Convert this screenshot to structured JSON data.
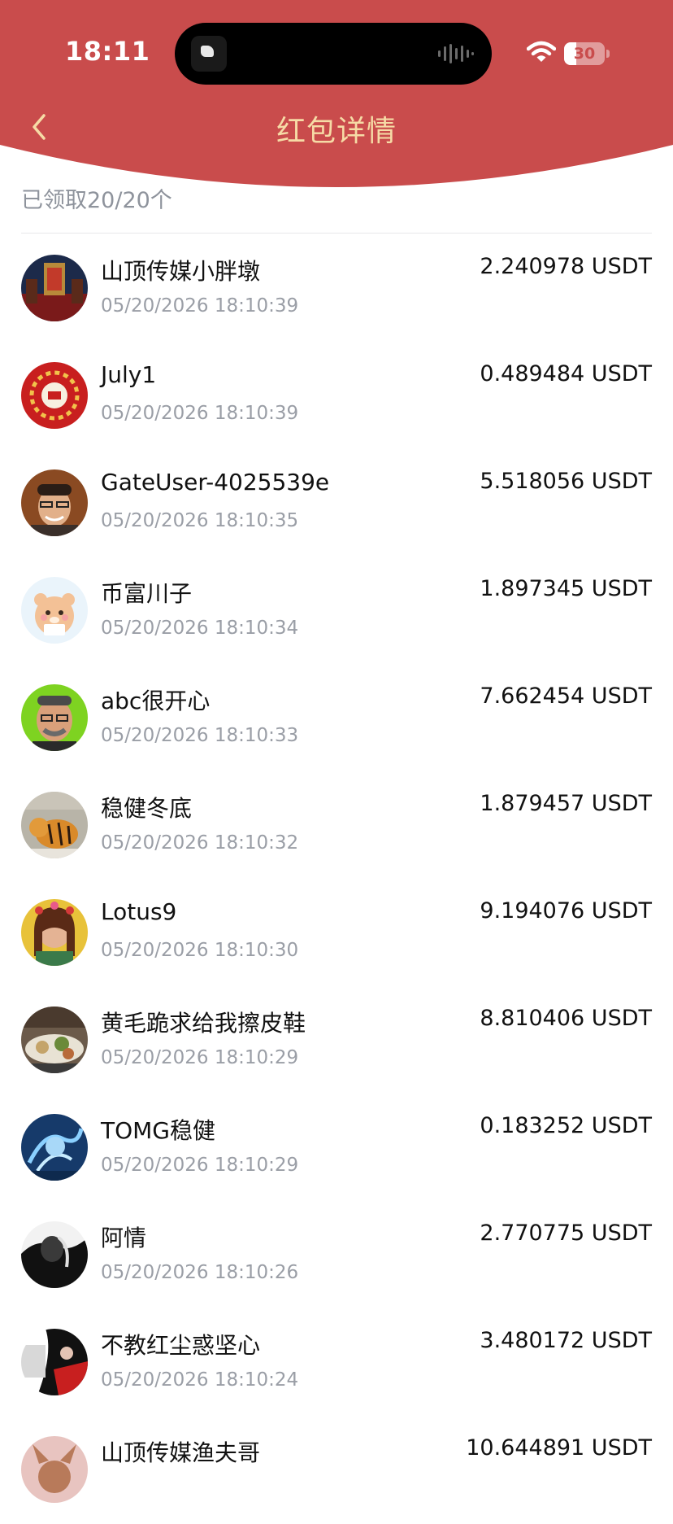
{
  "status_bar": {
    "time": "18:11",
    "battery_level": "30",
    "battery_fraction": 0.3
  },
  "header": {
    "title": "红包详情",
    "back_icon": "chevron-left-icon",
    "bg_color": "#c94c4c",
    "title_color": "#f6dba6"
  },
  "summary": {
    "text": "已领取20/20个"
  },
  "recipients": [
    {
      "name": "山顶传媒小胖墩",
      "time": "05/20/2026 18:10:39",
      "amount": "2.240978 USDT"
    },
    {
      "name": "July1",
      "time": "05/20/2026 18:10:39",
      "amount": "0.489484 USDT"
    },
    {
      "name": "GateUser-4025539e",
      "time": "05/20/2026 18:10:35",
      "amount": "5.518056 USDT"
    },
    {
      "name": "币富川子",
      "time": "05/20/2026 18:10:34",
      "amount": "1.897345 USDT"
    },
    {
      "name": "abc很开心",
      "time": "05/20/2026 18:10:33",
      "amount": "7.662454 USDT"
    },
    {
      "name": "稳健冬底",
      "time": "05/20/2026 18:10:32",
      "amount": "1.879457 USDT"
    },
    {
      "name": "Lotus9",
      "time": "05/20/2026 18:10:30",
      "amount": "9.194076 USDT"
    },
    {
      "name": "黄毛跪求给我擦皮鞋",
      "time": "05/20/2026 18:10:29",
      "amount": "8.810406 USDT"
    },
    {
      "name": "TOMG稳健",
      "time": "05/20/2026 18:10:29",
      "amount": "0.183252 USDT"
    },
    {
      "name": "阿情",
      "time": "05/20/2026 18:10:26",
      "amount": "2.770775 USDT"
    },
    {
      "name": "不教红尘惑坚心",
      "time": "05/20/2026 18:10:24",
      "amount": "3.480172 USDT"
    },
    {
      "name": "山顶传媒渔夫哥",
      "time": "",
      "amount": "10.644891 USDT"
    }
  ]
}
